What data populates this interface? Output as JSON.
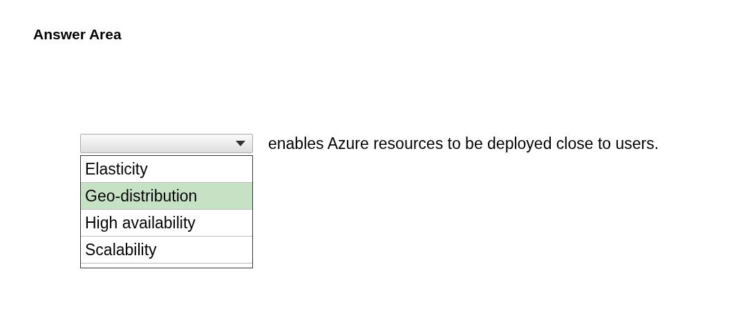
{
  "title": "Answer Area",
  "dropdown": {
    "expanded": true,
    "options": [
      {
        "label": "Elasticity",
        "selected": false
      },
      {
        "label": "Geo-distribution",
        "selected": true
      },
      {
        "label": "High availability",
        "selected": false
      },
      {
        "label": "Scalability",
        "selected": false
      }
    ]
  },
  "sentence": "enables Azure resources to be deployed close to users."
}
